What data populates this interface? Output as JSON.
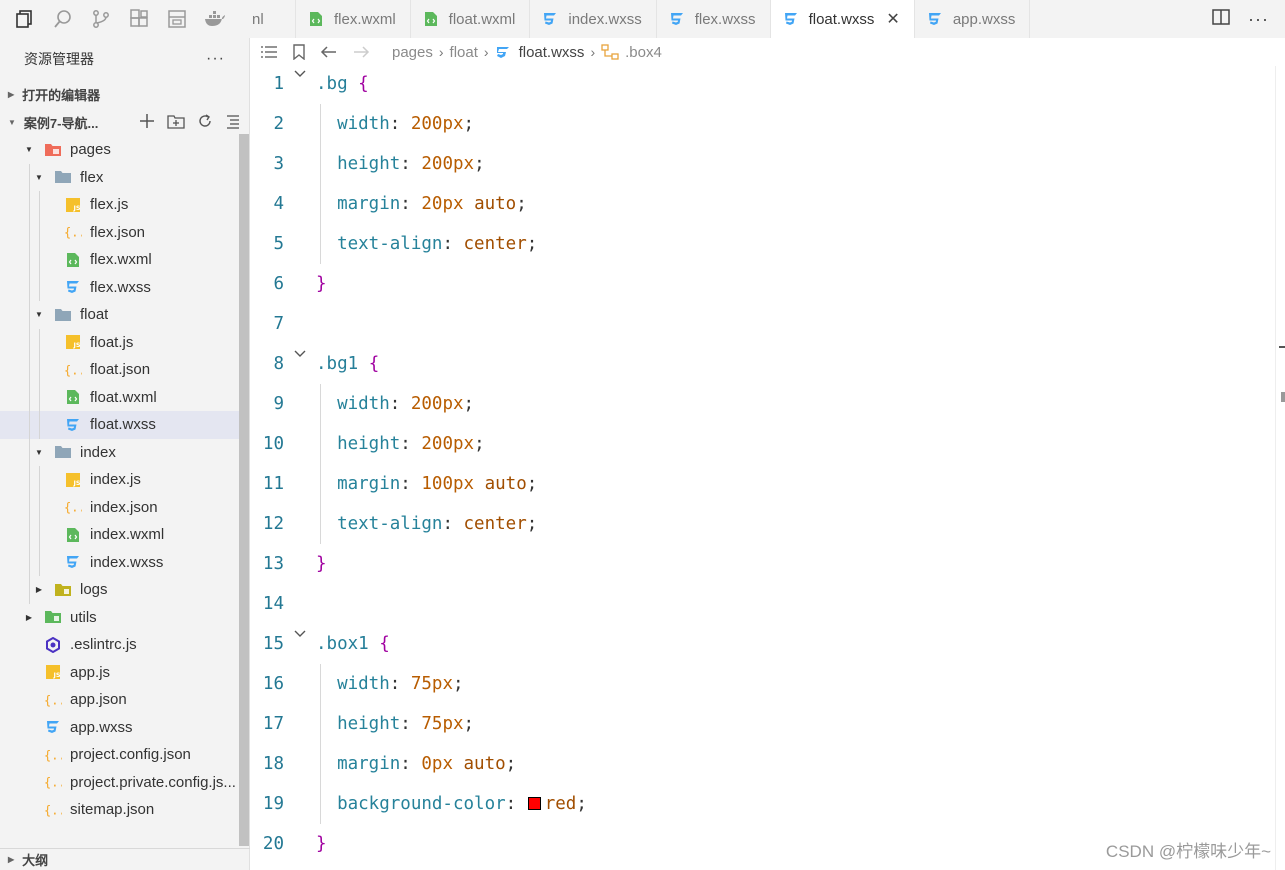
{
  "tabs": [
    {
      "label": "nl",
      "icon": "wxml-icon",
      "partial": true
    },
    {
      "label": "flex.wxml",
      "icon": "wxml-icon"
    },
    {
      "label": "float.wxml",
      "icon": "wxml-icon"
    },
    {
      "label": "index.wxss",
      "icon": "css-icon"
    },
    {
      "label": "flex.wxss",
      "icon": "css-icon"
    },
    {
      "label": "float.wxss",
      "icon": "css-icon",
      "active": true
    },
    {
      "label": "app.wxss",
      "icon": "css-icon"
    }
  ],
  "sidebar": {
    "title": "资源管理器",
    "more": "···",
    "open_editors": "打开的编辑器",
    "project": "案例7-导航...",
    "outline": "大纲",
    "tree": [
      {
        "label": "pages",
        "depth": 0,
        "type": "folder-pages",
        "caret": "▼"
      },
      {
        "label": "flex",
        "depth": 1,
        "type": "folder",
        "caret": "▼"
      },
      {
        "label": "flex.js",
        "depth": 2,
        "type": "js"
      },
      {
        "label": "flex.json",
        "depth": 2,
        "type": "json"
      },
      {
        "label": "flex.wxml",
        "depth": 2,
        "type": "wxml"
      },
      {
        "label": "flex.wxss",
        "depth": 2,
        "type": "wxss"
      },
      {
        "label": "float",
        "depth": 1,
        "type": "folder",
        "caret": "▼"
      },
      {
        "label": "float.js",
        "depth": 2,
        "type": "js"
      },
      {
        "label": "float.json",
        "depth": 2,
        "type": "json"
      },
      {
        "label": "float.wxml",
        "depth": 2,
        "type": "wxml"
      },
      {
        "label": "float.wxss",
        "depth": 2,
        "type": "wxss",
        "selected": true
      },
      {
        "label": "index",
        "depth": 1,
        "type": "folder",
        "caret": "▼"
      },
      {
        "label": "index.js",
        "depth": 2,
        "type": "js"
      },
      {
        "label": "index.json",
        "depth": 2,
        "type": "json"
      },
      {
        "label": "index.wxml",
        "depth": 2,
        "type": "wxml"
      },
      {
        "label": "index.wxss",
        "depth": 2,
        "type": "wxss"
      },
      {
        "label": "logs",
        "depth": 1,
        "type": "folder-logs",
        "caret": "▶"
      },
      {
        "label": "utils",
        "depth": 0,
        "type": "folder-utils",
        "caret": "▶"
      },
      {
        "label": ".eslintrc.js",
        "depth": 0,
        "type": "eslint"
      },
      {
        "label": "app.js",
        "depth": 0,
        "type": "js"
      },
      {
        "label": "app.json",
        "depth": 0,
        "type": "json"
      },
      {
        "label": "app.wxss",
        "depth": 0,
        "type": "wxss"
      },
      {
        "label": "project.config.json",
        "depth": 0,
        "type": "json"
      },
      {
        "label": "project.private.config.js...",
        "depth": 0,
        "type": "json"
      },
      {
        "label": "sitemap.json",
        "depth": 0,
        "type": "json"
      }
    ]
  },
  "breadcrumb": {
    "items": [
      "pages",
      "float",
      "float.wxss",
      ".box4"
    ]
  },
  "editor": {
    "lines": [
      {
        "n": "1",
        "fold": true,
        "tokens": [
          [
            "sel",
            ".bg"
          ],
          [
            "punct",
            " "
          ],
          [
            "brace",
            "{"
          ]
        ]
      },
      {
        "n": "2",
        "tokens": [
          [
            "prop",
            "  width"
          ],
          [
            "punct",
            ": "
          ],
          [
            "val",
            "200px"
          ],
          [
            "punct",
            ";"
          ]
        ]
      },
      {
        "n": "3",
        "tokens": [
          [
            "prop",
            "  height"
          ],
          [
            "punct",
            ": "
          ],
          [
            "val",
            "200px"
          ],
          [
            "punct",
            ";"
          ]
        ]
      },
      {
        "n": "4",
        "tokens": [
          [
            "prop",
            "  margin"
          ],
          [
            "punct",
            ": "
          ],
          [
            "val",
            "20px"
          ],
          [
            "kw",
            " auto"
          ],
          [
            "punct",
            ";"
          ]
        ]
      },
      {
        "n": "5",
        "tokens": [
          [
            "prop",
            "  text-align"
          ],
          [
            "punct",
            ": "
          ],
          [
            "kw",
            "center"
          ],
          [
            "punct",
            ";"
          ]
        ]
      },
      {
        "n": "6",
        "tokens": [
          [
            "brace",
            "}"
          ]
        ]
      },
      {
        "n": "7",
        "tokens": []
      },
      {
        "n": "8",
        "fold": true,
        "tokens": [
          [
            "sel",
            ".bg1"
          ],
          [
            "punct",
            " "
          ],
          [
            "brace",
            "{"
          ]
        ]
      },
      {
        "n": "9",
        "tokens": [
          [
            "prop",
            "  width"
          ],
          [
            "punct",
            ": "
          ],
          [
            "val",
            "200px"
          ],
          [
            "punct",
            ";"
          ]
        ]
      },
      {
        "n": "10",
        "tokens": [
          [
            "prop",
            "  height"
          ],
          [
            "punct",
            ": "
          ],
          [
            "val",
            "200px"
          ],
          [
            "punct",
            ";"
          ]
        ]
      },
      {
        "n": "11",
        "tokens": [
          [
            "prop",
            "  margin"
          ],
          [
            "punct",
            ": "
          ],
          [
            "val",
            "100px"
          ],
          [
            "kw",
            " auto"
          ],
          [
            "punct",
            ";"
          ]
        ]
      },
      {
        "n": "12",
        "tokens": [
          [
            "prop",
            "  text-align"
          ],
          [
            "punct",
            ": "
          ],
          [
            "kw",
            "center"
          ],
          [
            "punct",
            ";"
          ]
        ]
      },
      {
        "n": "13",
        "tokens": [
          [
            "brace",
            "}"
          ]
        ]
      },
      {
        "n": "14",
        "tokens": []
      },
      {
        "n": "15",
        "fold": true,
        "tokens": [
          [
            "sel",
            ".box1"
          ],
          [
            "punct",
            " "
          ],
          [
            "brace",
            "{"
          ]
        ]
      },
      {
        "n": "16",
        "tokens": [
          [
            "prop",
            "  width"
          ],
          [
            "punct",
            ": "
          ],
          [
            "val",
            "75px"
          ],
          [
            "punct",
            ";"
          ]
        ]
      },
      {
        "n": "17",
        "tokens": [
          [
            "prop",
            "  height"
          ],
          [
            "punct",
            ": "
          ],
          [
            "val",
            "75px"
          ],
          [
            "punct",
            ";"
          ]
        ]
      },
      {
        "n": "18",
        "tokens": [
          [
            "prop",
            "  margin"
          ],
          [
            "punct",
            ": "
          ],
          [
            "val",
            "0px"
          ],
          [
            "kw",
            " auto"
          ],
          [
            "punct",
            ";"
          ]
        ]
      },
      {
        "n": "19",
        "tokens": [
          [
            "prop",
            "  background-color"
          ],
          [
            "punct",
            ": "
          ],
          [
            "swatch",
            ""
          ],
          [
            "kw",
            "red"
          ],
          [
            "punct",
            ";"
          ]
        ]
      },
      {
        "n": "20",
        "tokens": [
          [
            "brace",
            "}"
          ]
        ]
      }
    ]
  },
  "watermark": "CSDN @柠檬味少年~",
  "colors": {
    "accent_css": "#42a5f5",
    "wxml_green": "#4caf50",
    "js_yellow": "#f5c02b",
    "json_yellow": "#f5a623",
    "line_number": "#237893",
    "swatch_red": "#ff0000"
  }
}
